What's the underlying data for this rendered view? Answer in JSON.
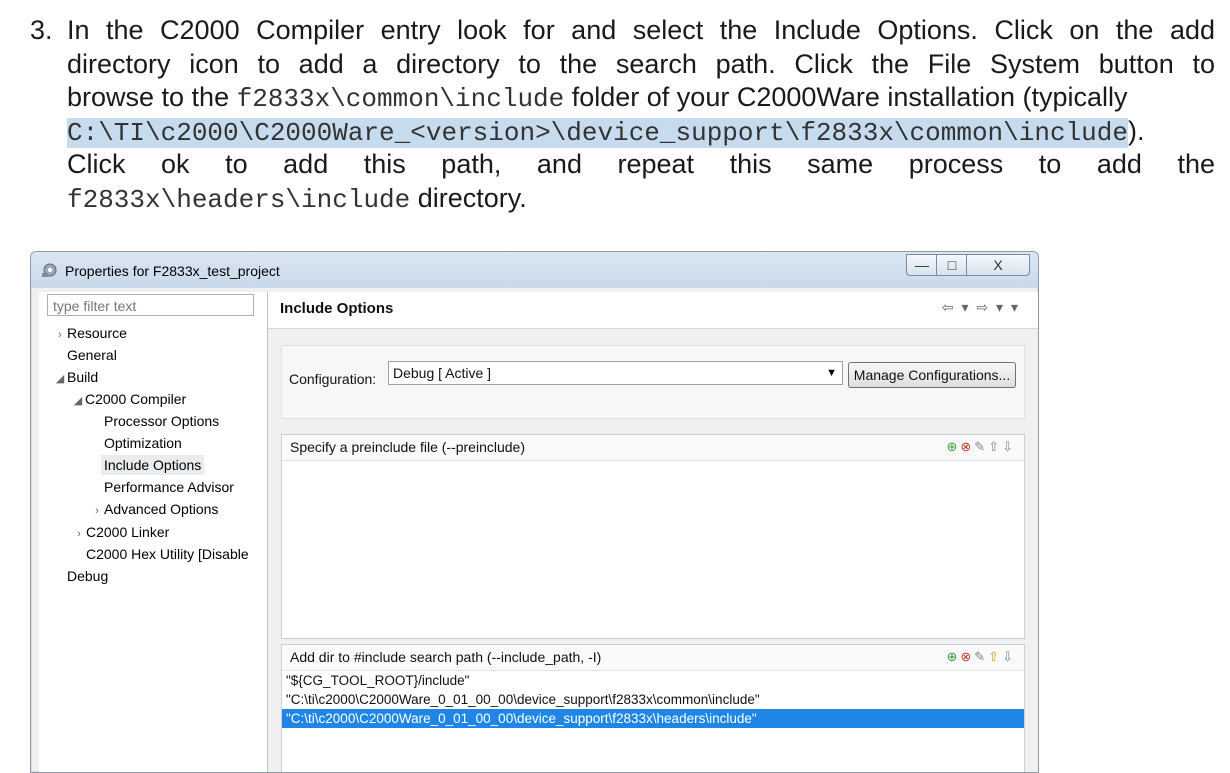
{
  "doc": {
    "step_number": "3.",
    "line1": "In the C2000 Compiler entry look for and select the Include Options.  Click on the add",
    "line2": "directory icon to add a directory to the search path.  Click the File System button to",
    "line3_pre": "browse to the ",
    "line3_mono": "f2833x\\common\\include",
    "line3_post": " folder of your C2000Ware installation (typically",
    "line4_mono": "C:\\TI\\c2000\\C2000Ware_<version>\\device_support\\f2833x\\common\\include",
    "line4_post": ").",
    "line5": "Click ok to add this path, and repeat this same process to add the",
    "line6_mono": "f2833x\\headers\\include",
    "line6_post": " directory."
  },
  "window": {
    "title": "Properties for F2833x_test_project",
    "controls": {
      "minimize": "—",
      "maximize": "□",
      "close": "X"
    }
  },
  "sidebar": {
    "filter_placeholder": "type filter text",
    "items": [
      {
        "label": "Resource",
        "arrow": "›"
      },
      {
        "label": "General",
        "arrow": ""
      },
      {
        "label": "Build",
        "arrow": "◢"
      },
      {
        "label": "C2000 Compiler",
        "arrow": "◢"
      },
      {
        "label": "Processor Options",
        "arrow": ""
      },
      {
        "label": "Optimization",
        "arrow": ""
      },
      {
        "label": "Include Options",
        "arrow": "",
        "selected": true
      },
      {
        "label": "Performance Advisor",
        "arrow": ""
      },
      {
        "label": "Advanced Options",
        "arrow": "›"
      },
      {
        "label": "C2000 Linker",
        "arrow": "›"
      },
      {
        "label": "C2000 Hex Utility  [Disable",
        "arrow": ""
      },
      {
        "label": "Debug",
        "arrow": ""
      }
    ]
  },
  "main": {
    "title": "Include Options",
    "nav_arrows": "⇦ ▾ ⇨ ▾ ▾",
    "configuration_label": "Configuration:",
    "configuration_value": "Debug  [ Active ]",
    "manage_button": "Manage Configurations...",
    "preinclude_label": "Specify a preinclude file (--preinclude)",
    "include_path_label": "Add dir to #include search path (--include_path, -I)",
    "include_paths": [
      "\"${CG_TOOL_ROOT}/include\"",
      "\"C:\\ti\\c2000\\C2000Ware_0_01_00_00\\device_support\\f2833x\\common\\include\"",
      "\"C:\\ti\\c2000\\C2000Ware_0_01_00_00\\device_support\\f2833x\\headers\\include\""
    ],
    "selected_path_index": 2
  },
  "colors": {
    "selection_blue": "#1f86e8",
    "text_highlight": "#c6dcee",
    "titlebar": "#c9d8ea"
  }
}
